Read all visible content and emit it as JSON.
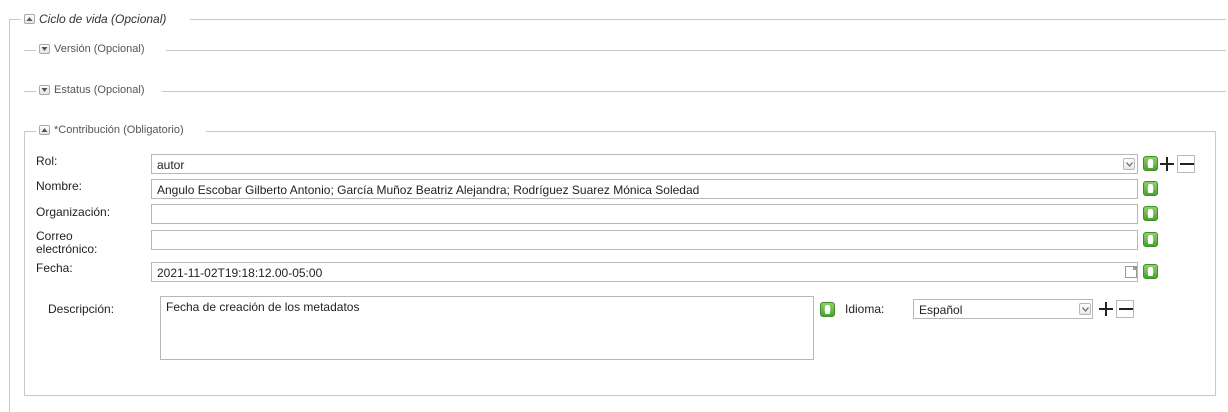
{
  "sections": {
    "ciclo_de_vida": "Ciclo de vida (Opcional)",
    "version": "Versión (Opcional)",
    "estatus": "Estatus (Opcional)",
    "contribucion": "*Contribución (Obligatorio)"
  },
  "form": {
    "rol": {
      "label": "Rol:",
      "value": "autor"
    },
    "nombre": {
      "label": "Nombre:",
      "value": "Angulo Escobar Gilberto Antonio; García Muñoz Beatriz Alejandra; Rodríguez Suarez Mónica Soledad"
    },
    "organizacion": {
      "label": "Organización:",
      "value": ""
    },
    "correo": {
      "label": "Correo electrónico:",
      "value": ""
    },
    "fecha": {
      "label": "Fecha:",
      "value": "2021-11-02T19:18:12.00-05:00"
    },
    "descripcion": {
      "label": "Descripción:",
      "value": "Fecha de creación de los metadatos"
    },
    "idioma": {
      "label": "Idioma:",
      "value": "Español"
    }
  },
  "colors": {
    "info_green": "#4aa32e",
    "border": "#c8c8c8"
  },
  "icons": [
    "collapse-up-icon",
    "expand-down-icon",
    "info-icon",
    "plus-icon",
    "minus-icon",
    "calendar-icon",
    "dropdown-arrow-icon"
  ]
}
